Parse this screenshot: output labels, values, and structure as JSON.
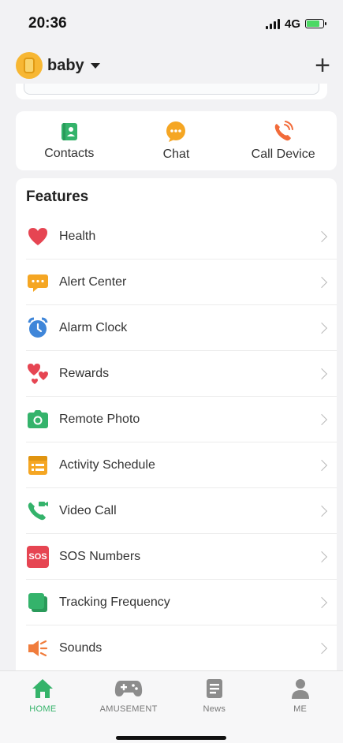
{
  "status": {
    "time": "20:36",
    "network": "4G",
    "battery_level": 0.8
  },
  "header": {
    "device_name": "baby",
    "add_symbol": "+"
  },
  "quick_actions": [
    {
      "label": "Contacts",
      "icon": "contacts-icon",
      "color": "#34b36b"
    },
    {
      "label": "Chat",
      "icon": "chat-icon",
      "color": "#f5a623"
    },
    {
      "label": "Call Device",
      "icon": "phone-call-icon",
      "color": "#f26b3a"
    }
  ],
  "features": {
    "title": "Features",
    "items": [
      {
        "label": "Health",
        "icon": "heart-icon",
        "color": "#e64552"
      },
      {
        "label": "Alert Center",
        "icon": "message-icon",
        "color": "#f5a623"
      },
      {
        "label": "Alarm Clock",
        "icon": "alarm-clock-icon",
        "color": "#3f86d9"
      },
      {
        "label": "Rewards",
        "icon": "hearts-icon",
        "color": "#e64552"
      },
      {
        "label": "Remote Photo",
        "icon": "camera-icon",
        "color": "#34b36b"
      },
      {
        "label": "Activity Schedule",
        "icon": "schedule-icon",
        "color": "#f5a623"
      },
      {
        "label": "Video Call",
        "icon": "video-call-icon",
        "color": "#34b36b"
      },
      {
        "label": "SOS Numbers",
        "icon": "sos-icon",
        "color": "#e64552",
        "badge": "SOS"
      },
      {
        "label": "Tracking Frequency",
        "icon": "tracking-icon",
        "color": "#34b36b"
      },
      {
        "label": "Sounds",
        "icon": "speaker-icon",
        "color": "#f07c3c"
      }
    ]
  },
  "tabs": [
    {
      "label": "HOME",
      "icon": "home-icon",
      "active": true
    },
    {
      "label": "AMUSEMENT",
      "icon": "gamepad-icon",
      "active": false
    },
    {
      "label": "News",
      "icon": "news-icon",
      "active": false
    },
    {
      "label": "ME",
      "icon": "person-icon",
      "active": false
    }
  ],
  "colors": {
    "accent": "#35b36a",
    "inactive": "#777777"
  }
}
